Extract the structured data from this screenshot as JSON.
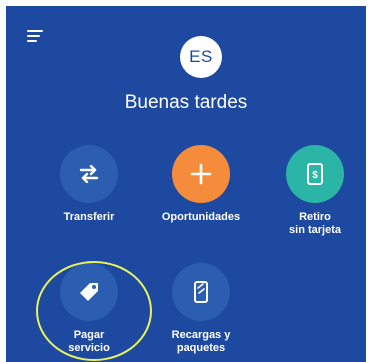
{
  "header": {
    "avatar_initials": "ES",
    "greeting": "Buenas tardes"
  },
  "icons": {
    "menu": "hamburger-menu-icon",
    "transfer": "transfer-arrows-icon",
    "opportunities": "plus-icon",
    "withdrawal": "cash-withdrawal-icon",
    "pay": "tag-icon",
    "recharge": "mobile-phone-icon"
  },
  "actions": {
    "transferir": {
      "label": "Transferir"
    },
    "oportunidades": {
      "label": "Oportunidades"
    },
    "retiro": {
      "line1": "Retiro",
      "line2": "sin tarjeta"
    },
    "pagar": {
      "line1": "Pagar",
      "line2": "servicio"
    },
    "recargas": {
      "line1": "Recargas y",
      "line2": "paquetes"
    }
  },
  "colors": {
    "background": "#1d49a0",
    "circle_default": "#2b5eb1",
    "circle_orange": "#f48c3c",
    "circle_teal": "#2bb5a6",
    "highlight_ring": "#e8f35a"
  }
}
